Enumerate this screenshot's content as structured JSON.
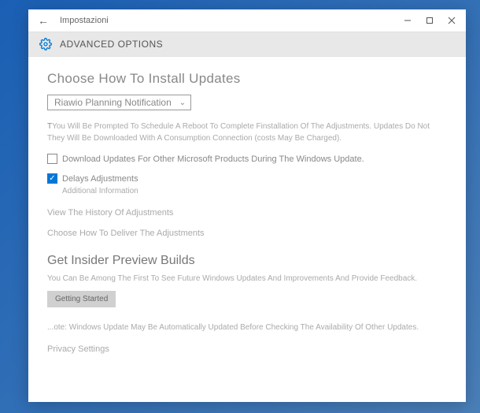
{
  "window": {
    "title": "Impostazioni"
  },
  "header": {
    "title": "ADVANCED OPTIONS"
  },
  "section1": {
    "heading": "Choose How To Install Updates",
    "dropdown_value": "Riawio Planning Notification",
    "info_lead": "T",
    "info_text": "You Will Be Prompted To Schedule A Reboot To Complete Finstallation Of The Adjustments. Updates Do Not They Will Be Downloaded With A Consumption Connection (costs May Be Charged).",
    "checkbox1_label": "Download Updates For Other Microsoft Products During The Windows Update.",
    "checkbox1_checked": false,
    "checkbox2_label": "Delays Adjustments",
    "checkbox2_checked": true,
    "checkbox2_sub": "Additional Information",
    "link1": "View The History Of Adjustments",
    "link2": "Choose How To Deliver The Adjustments"
  },
  "section2": {
    "heading": "Get Insider Preview Builds",
    "text": "You Can Be Among The First To See Future Windows Updates And Improvements And Provide Feedback.",
    "button": "Getting Started",
    "note": "...ote: Windows Update May Be Automatically Updated Before Checking The Availability Of Other Updates.",
    "privacy": "Privacy Settings"
  }
}
